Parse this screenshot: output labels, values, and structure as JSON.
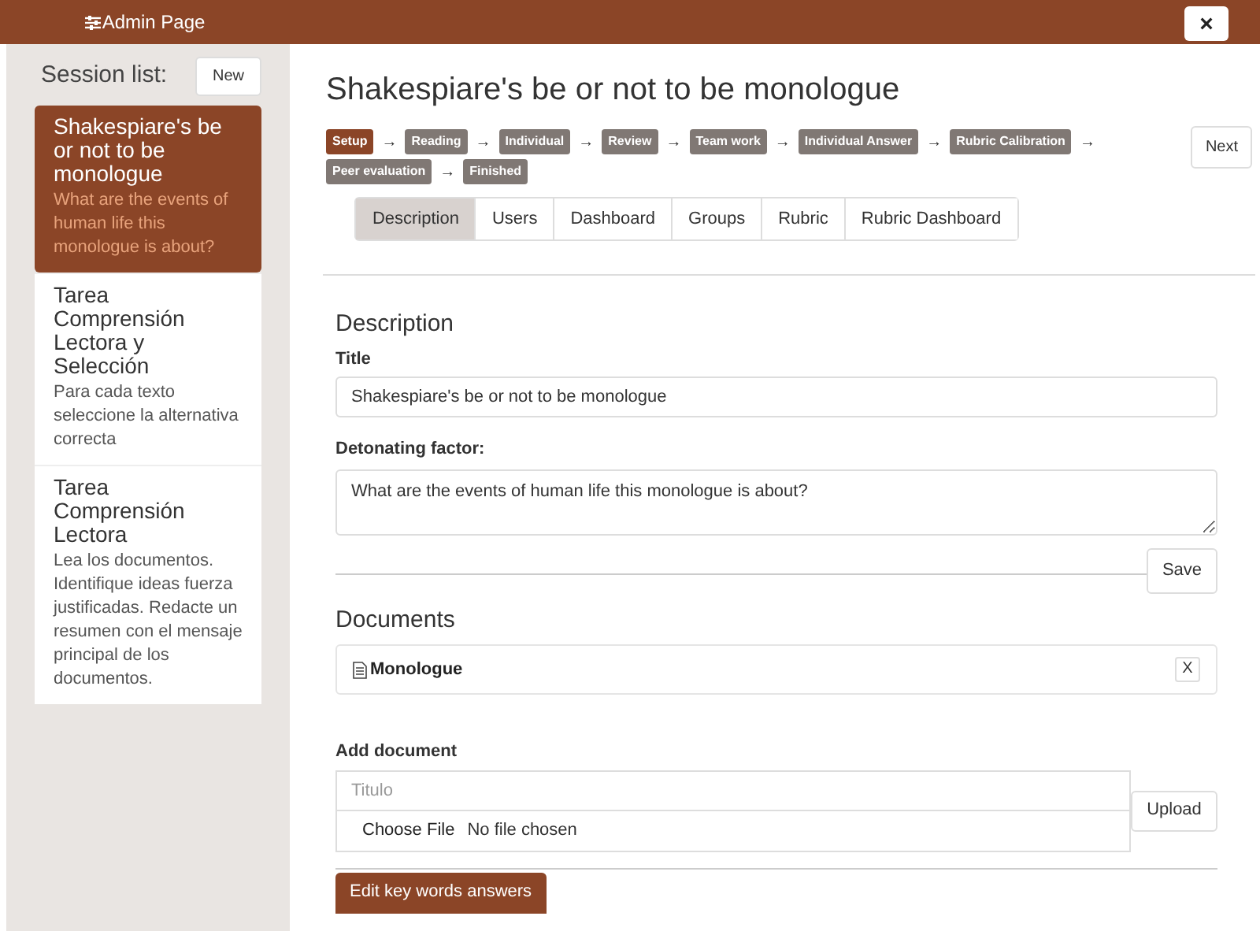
{
  "top_bar": {
    "title": "Admin Page",
    "close": "×"
  },
  "sidebar": {
    "title": "Session list:",
    "new_button": "New",
    "sessions": [
      {
        "title": "Shakespiare's be or not to be monologue",
        "description": "What are the events of human life this monologue is about?",
        "selected": true
      },
      {
        "title": "Tarea Comprensión Lectora y Selección",
        "description": "Para cada texto seleccione la alternativa correcta",
        "selected": false
      },
      {
        "title": "Tarea Comprensión Lectora",
        "description": "Lea los documentos. Identifique ideas fuerza justificadas. Redacte un resumen con el mensaje principal de los documentos.",
        "selected": false
      }
    ]
  },
  "heading": "Shakespiare's be or not to be monologue",
  "stages": [
    {
      "label": "Setup",
      "selected": true,
      "arrow": "→"
    },
    {
      "label": "Reading",
      "selected": false,
      "arrow": "→"
    },
    {
      "label": "Individual",
      "selected": false,
      "arrow": "→"
    },
    {
      "label": "Review",
      "selected": false,
      "arrow": "→"
    },
    {
      "label": "Team work",
      "selected": false,
      "arrow": "→"
    },
    {
      "label": "Individual Answer",
      "selected": false,
      "arrow": "→"
    },
    {
      "label": "Rubric Calibration",
      "selected": false,
      "arrow": "→"
    },
    {
      "label": "Peer evaluation",
      "selected": false,
      "arrow": "→"
    },
    {
      "label": "Finished",
      "selected": false
    }
  ],
  "next_button": "Next",
  "tabs": [
    {
      "label": "Description",
      "selected": true
    },
    {
      "label": "Users",
      "selected": false
    },
    {
      "label": "Dashboard",
      "selected": false
    },
    {
      "label": "Groups",
      "selected": false
    },
    {
      "label": "Rubric",
      "selected": false
    },
    {
      "label": "Rubric Dashboard",
      "selected": false
    }
  ],
  "description": {
    "heading": "Description",
    "title_label": "Title",
    "title_value": "Shakespiare's be or not to be monologue",
    "factor_label": "Detonating factor:",
    "factor_value": "What are the events of human life this monologue is about?",
    "save_button": "Save"
  },
  "documents": {
    "heading": "Documents",
    "items": [
      {
        "name": "Monologue",
        "remove": "X"
      }
    ]
  },
  "add_document": {
    "label": "Add document",
    "placeholder": "Titulo",
    "choose_button": "Choose File",
    "file_status": "No file chosen",
    "upload_button": "Upload"
  },
  "edit_button": "Edit key words answers"
}
